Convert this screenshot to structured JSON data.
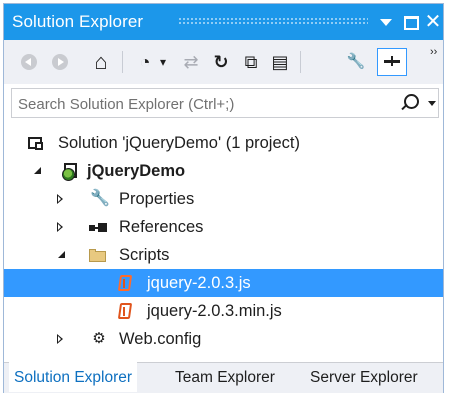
{
  "window": {
    "title": "Solution Explorer",
    "close_glyph": "✕"
  },
  "toolbar": {
    "icons": [
      "back-icon",
      "forward-icon",
      "home-icon",
      "history-icon",
      "sync-icon",
      "refresh-icon",
      "collapse-all-icon",
      "show-all-files-icon",
      "properties-wrench-icon",
      "preview-pin-icon"
    ],
    "home_glyph": "⌂",
    "history_glyph": "◔",
    "history_drop_glyph": "▾",
    "sync_glyph": "⇄",
    "refresh_glyph": "↻",
    "collapse_glyph": "⧉",
    "showall_glyph": "▤",
    "wrench_glyph": "🔧",
    "overflow_glyph": "››"
  },
  "search": {
    "placeholder": "Search Solution Explorer (Ctrl+;)"
  },
  "tree": {
    "solution": "Solution 'jQueryDemo' (1 project)",
    "project": "jQueryDemo",
    "properties": "Properties",
    "references": "References",
    "scripts": "Scripts",
    "file1": "jquery-2.0.3.js",
    "file2": "jquery-2.0.3.min.js",
    "webconfig": "Web.config",
    "selected_item": "jquery-2.0.3.js",
    "wrench_glyph": "🔧",
    "config_glyph": "⚙"
  },
  "tabs": {
    "solution_explorer": "Solution Explorer",
    "team_explorer": "Team Explorer",
    "server_explorer": "Server Explorer",
    "active": "Solution Explorer"
  },
  "colors": {
    "accent": "#1c97ea",
    "selection": "#3399ff",
    "active_tab_text": "#0e70c0",
    "js_icon": "#e0541c"
  }
}
